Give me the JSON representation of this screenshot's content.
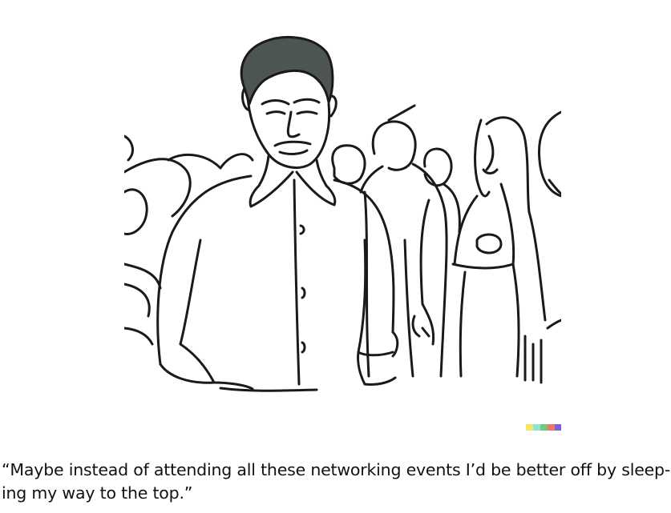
{
  "cartoon": {
    "caption_line_1": "“Maybe instead of attending all these networking events I’d be better off by sleep-",
    "caption_line_2": "ing my way to the top.”"
  },
  "signature_colors": [
    "#f5e663",
    "#8fe3d2",
    "#74c97a",
    "#e97b6b",
    "#7a63d8"
  ],
  "ink_color": "#1a1a1a",
  "hair_color": "#4d5550"
}
